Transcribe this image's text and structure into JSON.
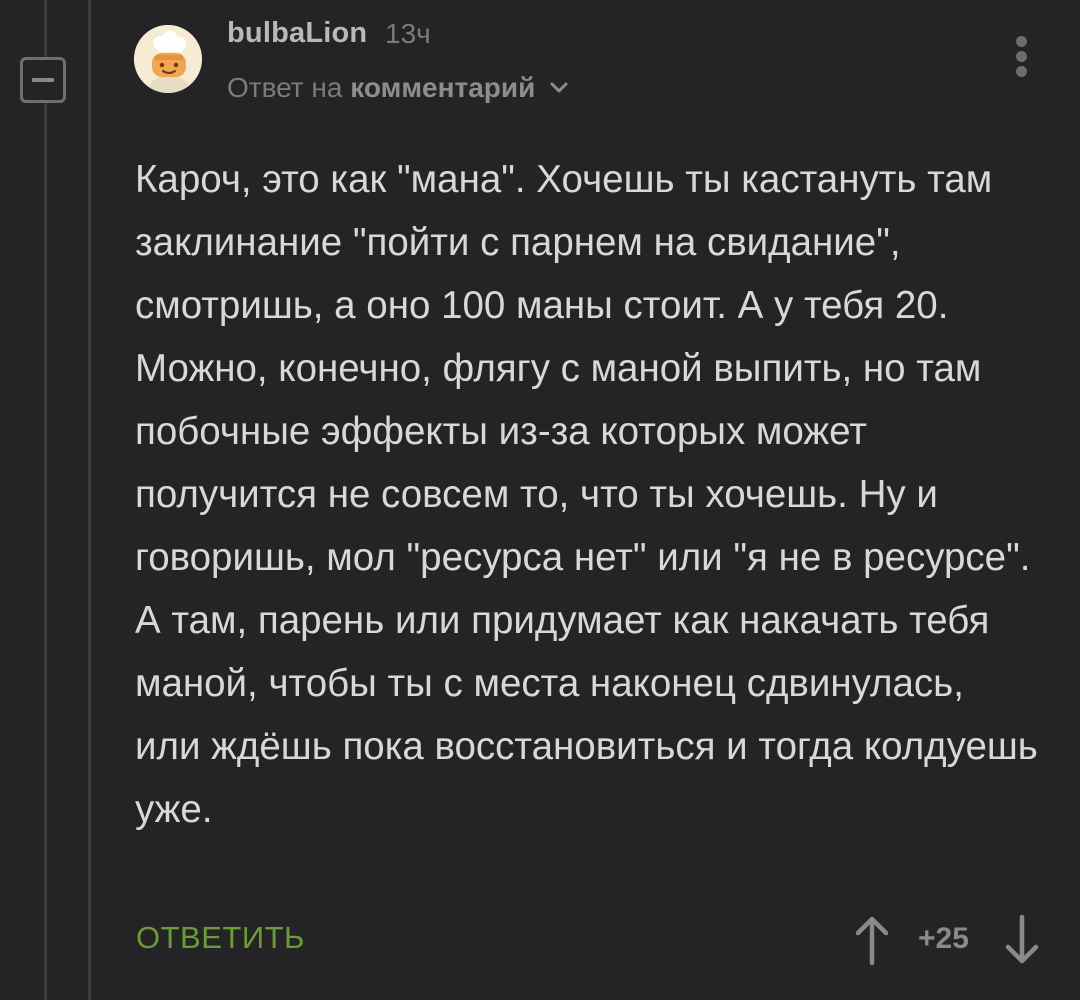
{
  "comment": {
    "author": "bulbaLion",
    "time_ago": "13ч",
    "reply_to_prefix": "Ответ на",
    "reply_to_link": "комментарий",
    "body": "Кароч, это как \"мана\". Хочешь ты кастануть там заклинание \"пойти с парнем на свидание\", смотришь, а оно 100 маны стоит. А у тебя 20. Можно, конечно, флягу с маной выпить, но там побочные эффекты из-за которых может получится не совсем то, что ты хочешь. Ну и говоришь, мол \"ресурса нет\" или \"я не в ресурсе\". А там, парень или придумает как накачать тебя маной, чтобы ты с места наконец сдвинулась, или ждёшь пока восстановиться и тогда колдуешь уже.",
    "reply_button": "ОТВЕТИТЬ",
    "rating": "+25"
  },
  "icons": {
    "collapse": "minus-square-icon",
    "more": "vertical-dots-icon",
    "chevron": "chevron-down-icon",
    "upvote": "arrow-up-icon",
    "downvote": "arrow-down-icon"
  },
  "colors": {
    "background": "#242426",
    "reply_accent": "#6b9a37",
    "text": "#d8d8d8",
    "muted": "#7b7b7e"
  }
}
